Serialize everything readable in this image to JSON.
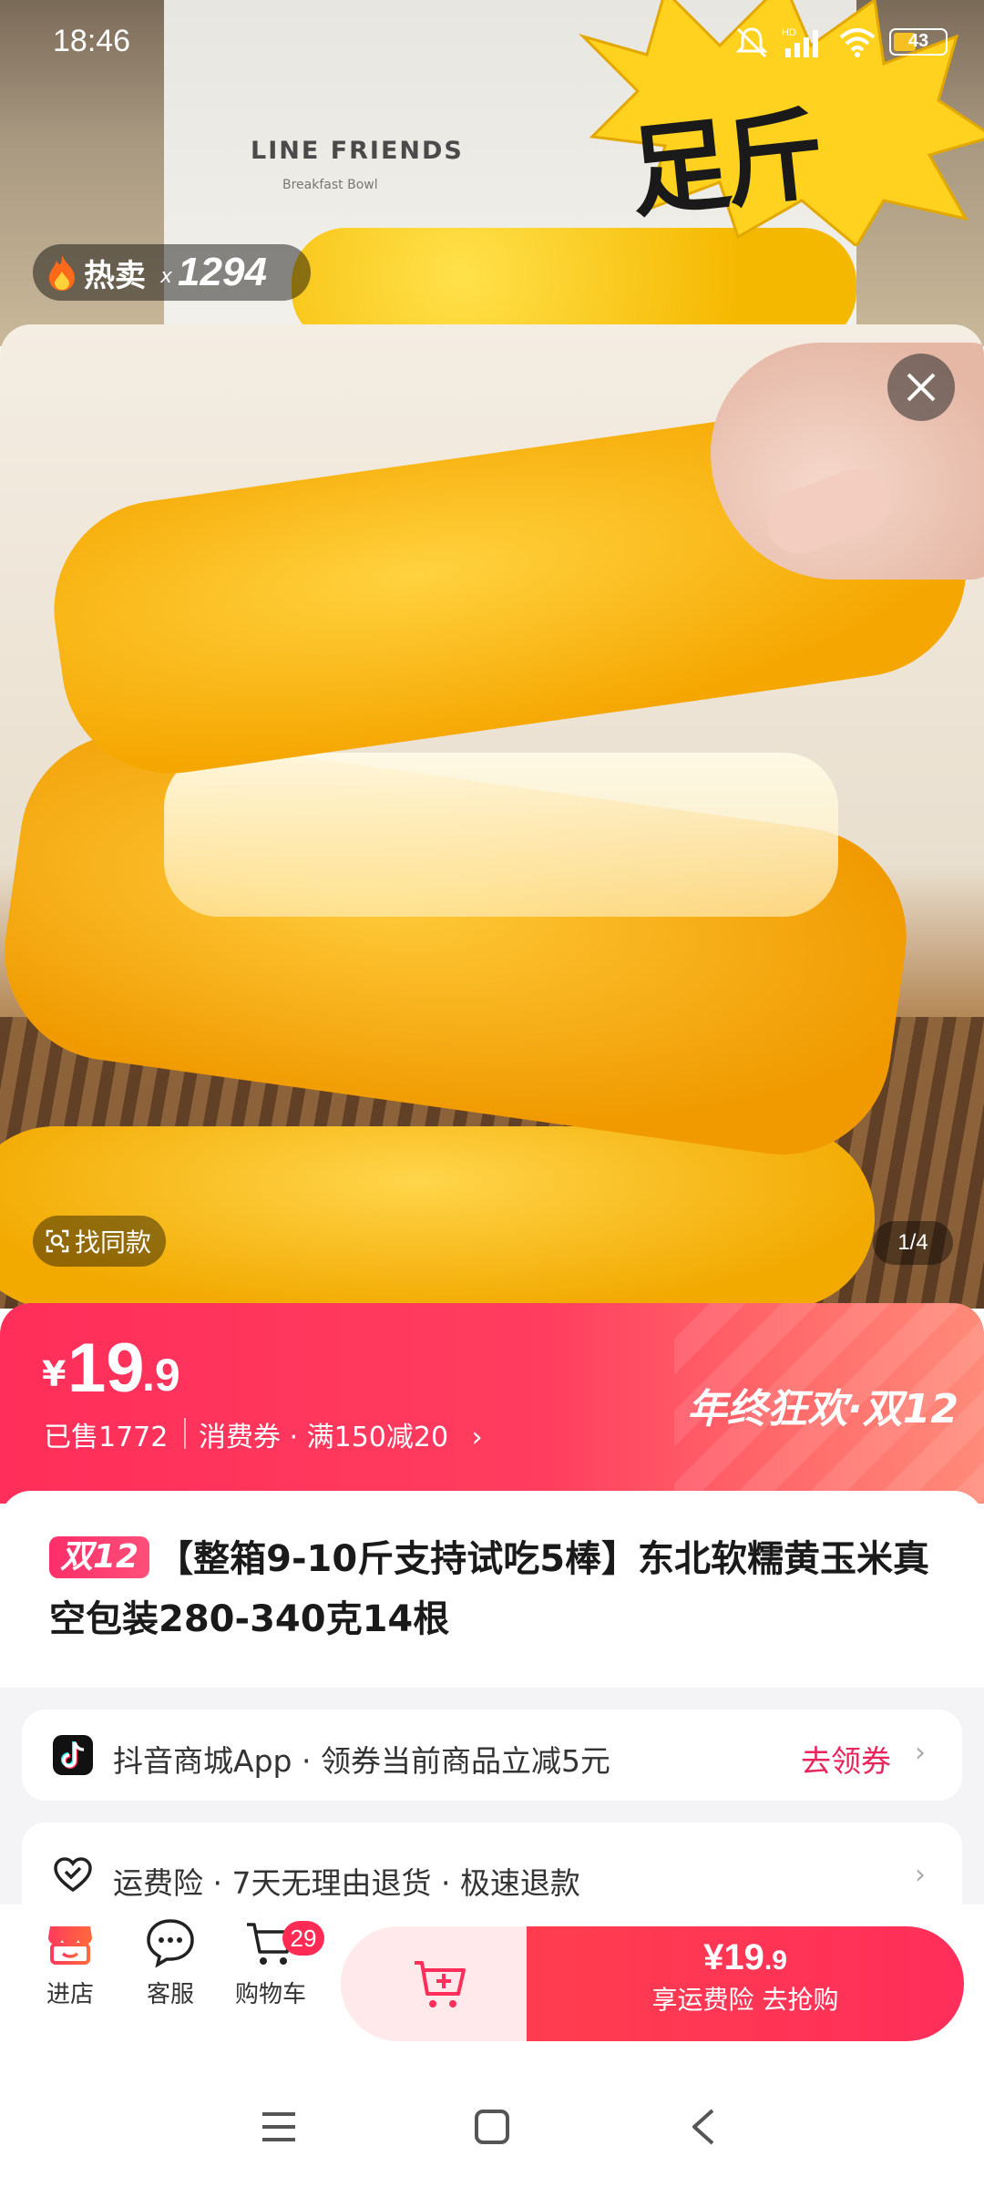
{
  "status_bar": {
    "time": "18:46",
    "battery": "43",
    "network": "HD"
  },
  "background": {
    "bag_brand": "LINE FRIENDS",
    "bag_sub": "Breakfast Bowl",
    "burst_text": "足斤"
  },
  "hot_sell": {
    "label": "热卖",
    "x": "x",
    "count": "1294"
  },
  "gallery": {
    "find_same": "找同款",
    "pager": "1/4"
  },
  "price": {
    "currency": "¥",
    "integer": "19",
    "decimal": ".9",
    "sold": "已售1772",
    "coupon": "消费券 · 满150减20",
    "promo_title": "年终狂欢·双12"
  },
  "product": {
    "tag": "双12",
    "title": "【整箱9-10斤支持试吃5棒】东北软糯黄玉米真空包装280-340克14根"
  },
  "app_coupon": {
    "label": "抖音商城App · 领券当前商品立减5元",
    "action": "去领券"
  },
  "service": {
    "label": "运费险 · 7天无理由退货 · 极速退款"
  },
  "bottom_bar": {
    "shop_label": "进店",
    "service_label": "客服",
    "cart_label": "购物车",
    "cart_badge": "29",
    "buy_price_currency": "¥",
    "buy_price_int": "19",
    "buy_price_dec": ".9",
    "buy_text": "享运费险  去抢购"
  },
  "colors": {
    "accent": "#ff2e5a",
    "link": "#e8265b"
  }
}
